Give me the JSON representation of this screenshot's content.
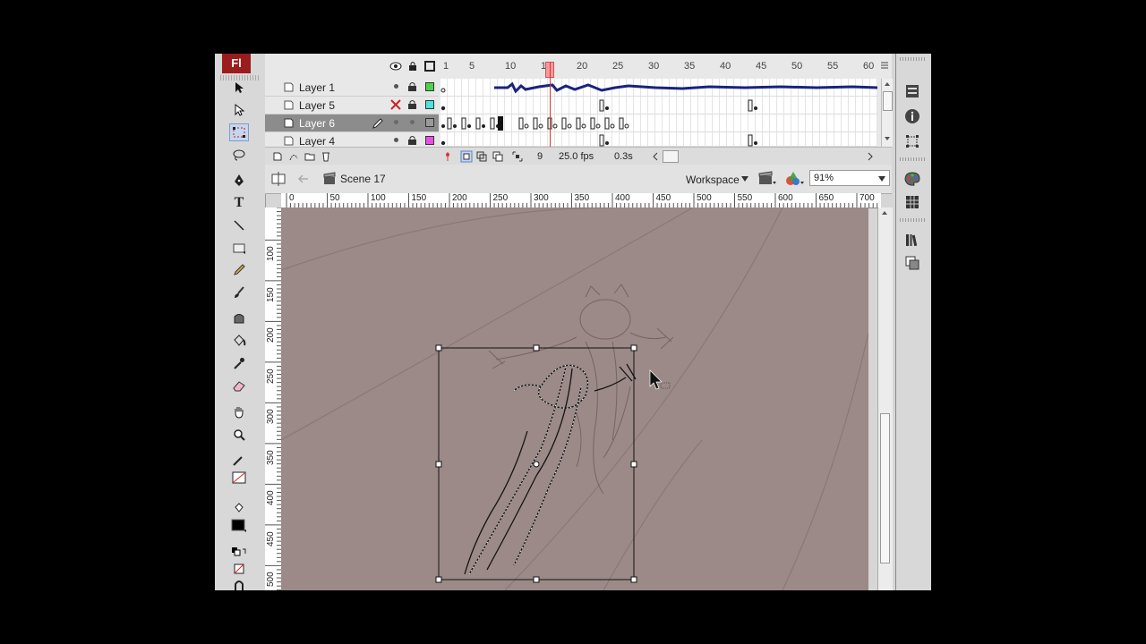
{
  "app": {
    "logo": "Fl"
  },
  "timeline": {
    "frame_numbers": [
      "1",
      "5",
      "10",
      "15",
      "20",
      "25",
      "30",
      "35",
      "40",
      "45",
      "50",
      "55",
      "60"
    ],
    "layers": [
      {
        "name": "Layer 1",
        "color": "#4ad44a",
        "visible_marker": "•",
        "selected": false
      },
      {
        "name": "Layer 5",
        "color": "#4fe0e0",
        "visible_marker": "✕",
        "selected": false
      },
      {
        "name": "Layer 6",
        "color": "#9a9a9a",
        "visible_marker": "•",
        "selected": true
      },
      {
        "name": "Layer 4",
        "color": "#e84fe8",
        "visible_marker": "•",
        "selected": false
      }
    ],
    "current_frame": "9",
    "fps": "25.0 fps",
    "time": "0.3s"
  },
  "editbar": {
    "scene": "Scene 17",
    "workspace": "Workspace",
    "zoom": "91%"
  },
  "rulers": {
    "horizontal": [
      "0",
      "50",
      "100",
      "150",
      "200",
      "250",
      "300",
      "350",
      "400",
      "450",
      "500",
      "550",
      "600",
      "650",
      "700"
    ],
    "vertical": [
      "100",
      "150",
      "200",
      "250",
      "300",
      "350",
      "400",
      "450",
      "500"
    ]
  },
  "colors": {
    "stage": "#9c8a88",
    "logo_bg": "#9b1c1c",
    "playhead": "#d33333"
  },
  "icons": {
    "selection": "arrow-icon",
    "subselection": "subselect-arrow-icon",
    "free_transform": "free-transform-icon",
    "lasso": "lasso-icon",
    "pen": "pen-icon",
    "text": "text-icon",
    "line": "line-icon",
    "rectangle": "rectangle-icon",
    "pencil": "pencil-icon",
    "brush": "brush-icon",
    "ink_bottle": "ink-bottle-icon",
    "paint_bucket": "paint-bucket-icon",
    "eyedropper": "eyedropper-icon",
    "eraser": "eraser-icon",
    "hand": "hand-icon",
    "zoom": "zoom-icon"
  }
}
